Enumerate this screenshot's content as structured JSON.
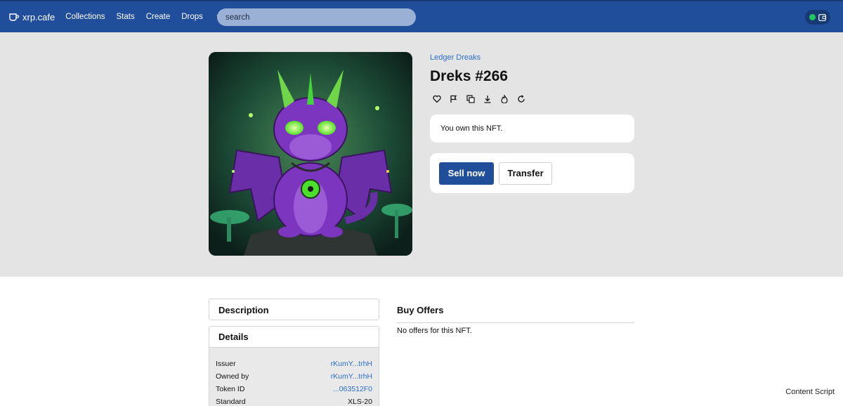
{
  "brand": {
    "name": "xrp.cafe"
  },
  "nav": {
    "items": [
      "Collections",
      "Stats",
      "Create",
      "Drops"
    ]
  },
  "search": {
    "placeholder": "search"
  },
  "nft": {
    "collection": "Ledger Dreaks",
    "title": "Dreks #266",
    "ownership_text": "You own this NFT.",
    "sell_label": "Sell now",
    "transfer_label": "Transfer"
  },
  "actions": [
    "heart-icon",
    "flag-icon",
    "copy-icon",
    "download-icon",
    "burn-icon",
    "refresh-icon"
  ],
  "description": {
    "heading": "Description"
  },
  "details": {
    "heading": "Details",
    "rows": [
      {
        "label": "Issuer",
        "value": "rKumY...trhH"
      },
      {
        "label": "Owned by",
        "value": "rKumY...trhH"
      },
      {
        "label": "Token ID",
        "value": "...063512F0"
      },
      {
        "label": "Standard",
        "value": "XLS-20"
      }
    ]
  },
  "offers": {
    "heading": "Buy Offers",
    "empty_text": "No offers for this NFT."
  },
  "footer": {
    "content_script": "Content Script"
  },
  "colors": {
    "nav_bg": "#214e9b",
    "accent": "#2c6fce",
    "hero_bg": "#e4e4e4",
    "status_dot": "#22c55e"
  }
}
